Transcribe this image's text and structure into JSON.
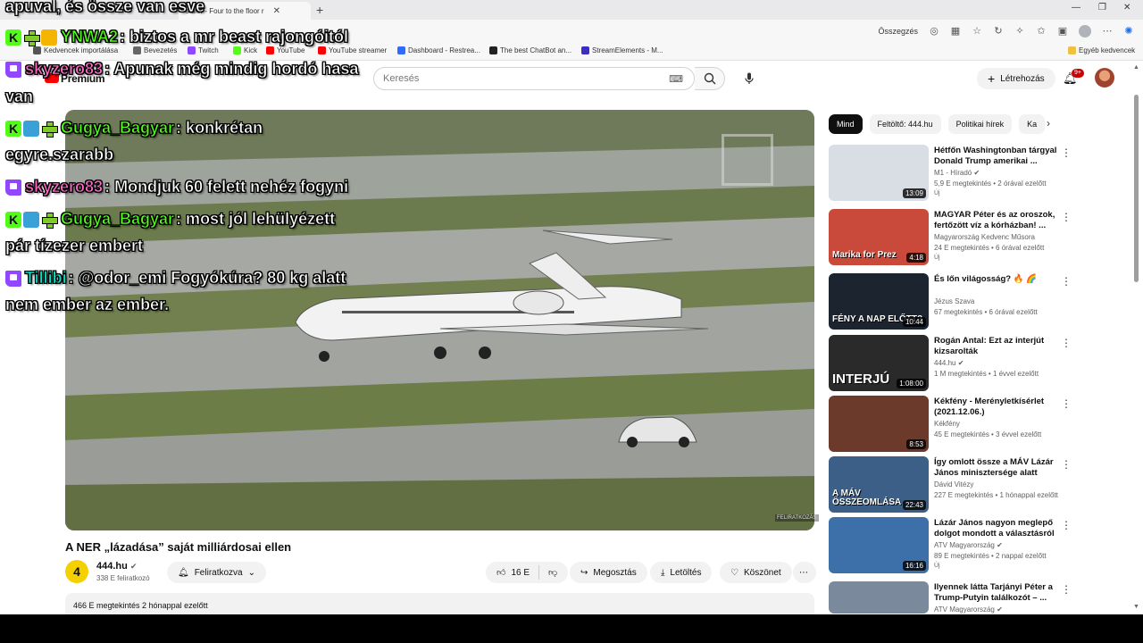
{
  "browser": {
    "tab_title": "sailor - Four to the floor r",
    "window_controls": [
      "—",
      "❐",
      "✕"
    ],
    "addr_label": "Összegzés"
  },
  "bookmarks": [
    {
      "label": "Kedvencek importálása",
      "color": "#555555"
    },
    {
      "label": "Bevezetés",
      "color": "#666666"
    },
    {
      "label": "Twitch",
      "color": "#9146ff"
    },
    {
      "label": "Kick",
      "color": "#53fc18"
    },
    {
      "label": "YouTube",
      "color": "#ff0000"
    },
    {
      "label": "YouTube streamer",
      "color": "#ff0000"
    },
    {
      "label": "Dashboard - Restrea...",
      "color": "#2f6bff"
    },
    {
      "label": "The best ChatBot an...",
      "color": "#222222"
    },
    {
      "label": "StreamElements - M...",
      "color": "#3b2ec2"
    }
  ],
  "bookmarks_right": "Egyéb kedvencek",
  "youtube": {
    "logo_text": "Premium",
    "search_placeholder": "Keresés",
    "create_label": "Létrehozás",
    "notif_count": "9+"
  },
  "video": {
    "title": "A NER „lázadása” saját milliárdosai ellen",
    "channel": "444.hu",
    "channel_avatar_text": "4",
    "subscribers": "338 E feliratkozó",
    "subscribe_label": "Feliratkozva",
    "likes": "16 E",
    "share_label": "Megosztás",
    "download_label": "Letöltés",
    "thanks_label": "Köszönet",
    "views_line": "466 E megtekintés  2 hónappal ezelőtt",
    "caption_badge": "FELIRATKOZÁS"
  },
  "chips": [
    "Mind",
    "Feltöltő: 444.hu",
    "Politikai hírek",
    "Ka"
  ],
  "recommendations": [
    {
      "title": "Hétfőn Washingtonban tárgyal Donald Trump amerikai ...",
      "channel": "M1 - Híradó",
      "verified": true,
      "meta": "5,9 E megtekintés • 2 órával ezelőtt",
      "badge": "Új",
      "duration": "13:09",
      "bg": "#d9dde4",
      "thumb_text": ""
    },
    {
      "title": "MAGYAR Péter és az oroszok, fertőzött víz a kórházban! ...",
      "channel": "Magyarország Kedvenc Műsora",
      "verified": false,
      "meta": "24 E megtekintés • 6 órával ezelőtt",
      "badge": "Új",
      "duration": "4:18",
      "bg": "#c94a3a",
      "thumb_text": "Marika for Prez"
    },
    {
      "title": "És lőn világosság? 🔥 🌈",
      "channel": "Jézus Szava",
      "verified": false,
      "meta": "67 megtekintés • 6 órával ezelőtt",
      "badge": "",
      "duration": "10:44",
      "bg": "#1c2430",
      "thumb_text": "FÉNY A NAP ELŐTT?"
    },
    {
      "title": "Rogán Antal: Ezt az interjút kizsarolták",
      "channel": "444.hu",
      "verified": true,
      "meta": "1 M megtekintés • 1 évvel ezelőtt",
      "badge": "",
      "duration": "1:08:00",
      "bg": "#2a2a2a",
      "thumb_text": "INTERJÚ"
    },
    {
      "title": "Kékfény - Merényletkísérlet (2021.12.06.)",
      "channel": "Kékfény",
      "verified": false,
      "meta": "45 E megtekintés • 3 évvel ezelőtt",
      "badge": "",
      "duration": "8:53",
      "bg": "#6b3a2a",
      "thumb_text": ""
    },
    {
      "title": "Így omlott össze a MÁV Lázár János minisztersége alatt",
      "channel": "Dávid Vitézy",
      "verified": false,
      "meta": "227 E megtekintés • 1 hónappal ezelőtt",
      "badge": "",
      "duration": "22:43",
      "bg": "#3b5f86",
      "thumb_text": "A MÁV ÖSSZEOMLÁSA"
    },
    {
      "title": "Lázár János nagyon meglepő dolgot mondott a választásról",
      "channel": "ATV Magyarország",
      "verified": true,
      "meta": "89 E megtekintés • 2 nappal ezelőtt",
      "badge": "Új",
      "duration": "16:16",
      "bg": "#3d6fa8",
      "thumb_text": ""
    },
    {
      "title": "Ilyennek látta Tarjányi Péter a Trump-Putyin találkozót – ...",
      "channel": "ATV Magyarország",
      "verified": true,
      "meta": "",
      "badge": "",
      "duration": "",
      "bg": "#7a8a9c",
      "thumb_text": ""
    }
  ],
  "chat": [
    {
      "badges": [],
      "user": "",
      "user_color": "#ffffff",
      "text": "apuval, és össze van esve"
    },
    {
      "badges": [
        "kick",
        "plus",
        "crown"
      ],
      "user": "YNWA2",
      "user_color": "#53fc18",
      "text": ": biztos a mr beast rajongóitól"
    },
    {
      "badges": [
        "twitch"
      ],
      "user": "skyzero83",
      "user_color": "#ff69c8",
      "text": ": Apunak még mindig hordó hasa"
    },
    {
      "badges": [],
      "user": "",
      "user_color": "#ffffff",
      "text": "van"
    },
    {
      "badges": [
        "kick",
        "sword",
        "plus"
      ],
      "user": "Gugya_Bagyar",
      "user_color": "#53fc18",
      "text": ": konkrétan"
    },
    {
      "badges": [],
      "user": "",
      "user_color": "#ffffff",
      "text": "egyre.szarabb"
    },
    {
      "badges": [
        "twitch"
      ],
      "user": "skyzero83",
      "user_color": "#ff69c8",
      "text": ": Mondjuk 60 felett nehéz fogyni"
    },
    {
      "badges": [
        "kick",
        "sword",
        "plus"
      ],
      "user": "Gugya_Bagyar",
      "user_color": "#53fc18",
      "text": ": most jól lehülyézett"
    },
    {
      "badges": [],
      "user": "",
      "user_color": "#ffffff",
      "text": "pár tízezer embert"
    },
    {
      "badges": [
        "twitch"
      ],
      "user": "Tillibi",
      "user_color": "#00e5c8",
      "text": ": @odor_emi Fogyókúra? 80 kg alatt"
    },
    {
      "badges": [],
      "user": "",
      "user_color": "#ffffff",
      "text": "nem ember az ember."
    }
  ]
}
